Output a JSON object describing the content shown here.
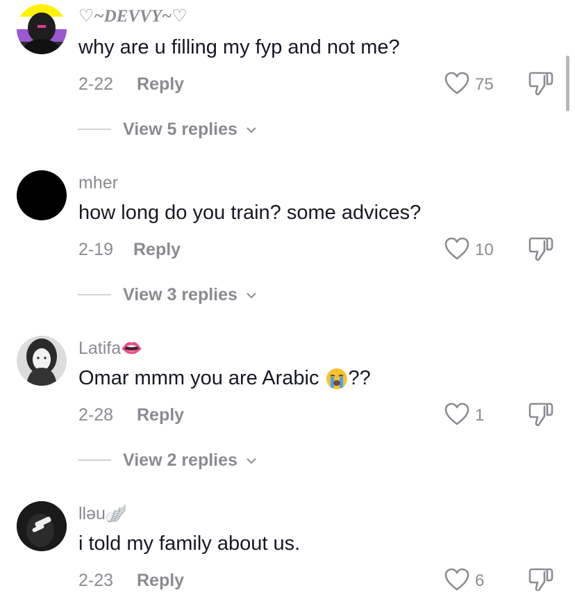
{
  "comments": [
    {
      "username": "♡~DEVVY~♡",
      "text": "why are u filling my fyp and not me?",
      "date": "2-22",
      "reply_label": "Reply",
      "likes": "75",
      "view_replies": "View 5 replies"
    },
    {
      "username": "mher",
      "text": "how long do you train? some advices?",
      "date": "2-19",
      "reply_label": "Reply",
      "likes": "10",
      "view_replies": "View 3 replies"
    },
    {
      "username": "Latifa👄",
      "text": "Omar mmm you are Arabic ",
      "text_suffix": "??",
      "date": "2-28",
      "reply_label": "Reply",
      "likes": "1",
      "view_replies": "View 2 replies"
    },
    {
      "username": "llǝu🪽",
      "text": "i told my family about us.",
      "date": "2-23",
      "reply_label": "Reply",
      "likes": "6"
    }
  ],
  "icons": {
    "like": "heart-outline-icon",
    "dislike": "thumbs-down-icon",
    "chevron": "chevron-down-icon",
    "crying_emoji": "loudly-crying-face-emoji"
  },
  "colors": {
    "text": "#161823",
    "muted": "#8a8b91",
    "divider": "#d0d1d3",
    "background": "#ffffff"
  }
}
